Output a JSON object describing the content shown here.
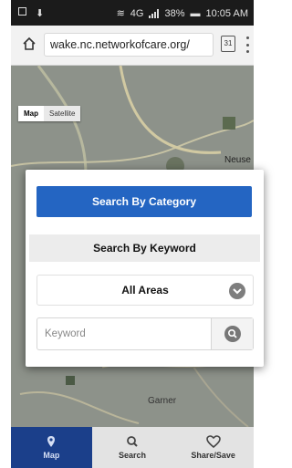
{
  "status_bar": {
    "network": "4G",
    "battery": "38%",
    "time": "10:05 AM"
  },
  "browser": {
    "url": "wake.nc.networkofcare.org/",
    "tab_count": "31"
  },
  "map": {
    "type_buttons": [
      "Map",
      "Satellite"
    ],
    "labels": {
      "neuse": "Neuse",
      "garner": "Garner"
    }
  },
  "search_panel": {
    "category_button": "Search By Category",
    "keyword_header": "Search By Keyword",
    "area_select": "All Areas",
    "keyword_placeholder": "Keyword"
  },
  "bottom_nav": {
    "items": [
      "Map",
      "Search",
      "Share/Save"
    ],
    "active": "Map"
  },
  "colors": {
    "primary_button": "#2465c2",
    "nav_active": "#1b3f8a",
    "map_base": "#8a8f86"
  }
}
